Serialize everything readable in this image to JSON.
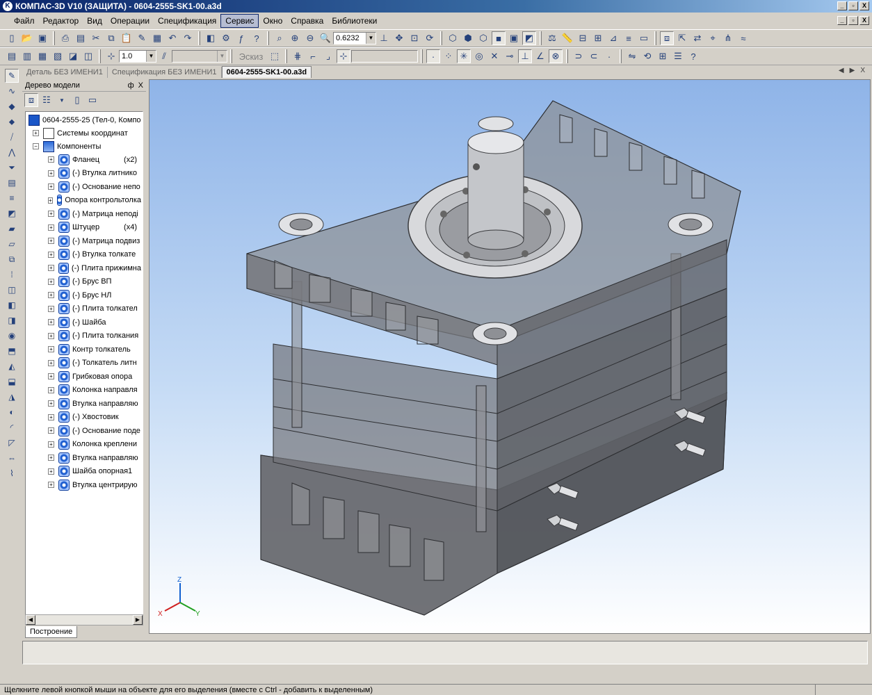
{
  "window": {
    "title": "КОМПАС-3D V10 (ЗАЩИТА) - 0604-2555-SK1-00.a3d",
    "app_icon_letter": "K",
    "controls": [
      "_",
      "▫",
      "X"
    ]
  },
  "menu": {
    "items": [
      "Файл",
      "Редактор",
      "Вид",
      "Операции",
      "Спецификация",
      "Сервис",
      "Окно",
      "Справка",
      "Библиотеки"
    ],
    "active": "Сервис"
  },
  "toolbar1": {
    "zoom_value": "0.6232"
  },
  "toolbar2": {
    "line_width": "1.0",
    "sketch_label": "Эскиз"
  },
  "tabs": [
    {
      "label": "Деталь БЕЗ ИМЕНИ1",
      "active": false
    },
    {
      "label": "Спецификация БЕЗ ИМЕНИ1",
      "active": false
    },
    {
      "label": "0604-2555-SK1-00.a3d",
      "active": true
    }
  ],
  "tree_panel": {
    "title": "Дерево модели",
    "pin": "ф",
    "close": "X",
    "bottom_tab": "Построение",
    "root": "0604-2555-25 (Тел-0, Компо",
    "coord_systems": "Системы координат",
    "components_group": "Компоненты",
    "components": [
      {
        "label": "Фланец",
        "count": "(x2)"
      },
      {
        "label": "(-) Втулка литнико"
      },
      {
        "label": "(-) Основание непо"
      },
      {
        "label": "Опора контрольтолка"
      },
      {
        "label": "(-) Матрица неподі"
      },
      {
        "label": "Штуцер",
        "count": "(x4)"
      },
      {
        "label": "(-) Матрица подвиз"
      },
      {
        "label": "(-) Втулка толкате"
      },
      {
        "label": "(-) Плита прижимна"
      },
      {
        "label": "(-) Брус ВП"
      },
      {
        "label": "(-) Брус НЛ"
      },
      {
        "label": "(-) Плита толкател"
      },
      {
        "label": "(-) Шайба"
      },
      {
        "label": "(-) Плита толкания"
      },
      {
        "label": "Контр толкатель"
      },
      {
        "label": "(-) Толкатель литн"
      },
      {
        "label": "Грибковая опора"
      },
      {
        "label": "Колонка направля"
      },
      {
        "label": "Втулка направляю"
      },
      {
        "label": "(-) Хвостовик"
      },
      {
        "label": "(-) Основание поде"
      },
      {
        "label": "Колонка креплени"
      },
      {
        "label": "Втулка направляю"
      },
      {
        "label": "Шайба опорная1"
      },
      {
        "label": "Втулка центрирую"
      }
    ]
  },
  "axes": {
    "z": "Z",
    "x": "X",
    "y": "Y"
  },
  "status": {
    "hint": "Щелкните левой кнопкой мыши на объекте для его выделения (вместе с Ctrl - добавить к выделенным)"
  },
  "colors": {
    "title_start": "#0a246a",
    "title_end": "#a6caf0",
    "viewport_top": "#8fb4e8",
    "component_icon": "#1f5fd0"
  }
}
